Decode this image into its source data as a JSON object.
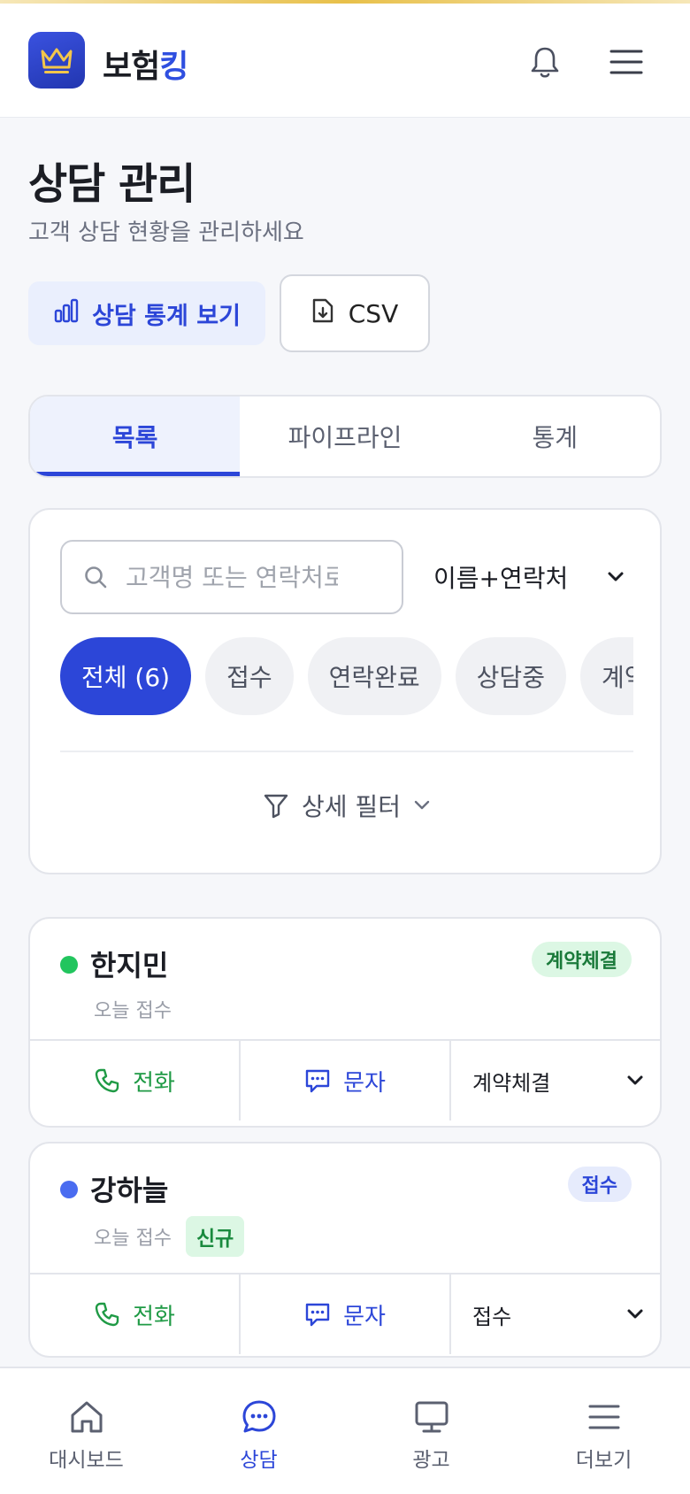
{
  "app": {
    "brand_part1": "보험",
    "brand_part2": "킹"
  },
  "page": {
    "title": "상담 관리",
    "subtitle": "고객 상담 현황을 관리하세요"
  },
  "toolbar": {
    "stats_label": "상담 통계 보기",
    "csv_label": "CSV"
  },
  "tabs": [
    {
      "label": "목록",
      "active": true
    },
    {
      "label": "파이프라인",
      "active": false
    },
    {
      "label": "통계",
      "active": false
    }
  ],
  "search": {
    "placeholder": "고객명 또는 연락처로 검색",
    "value": "",
    "type_selected": "이름+연락처"
  },
  "chips": [
    {
      "label": "전체 (6)",
      "active": true
    },
    {
      "label": "접수",
      "active": false
    },
    {
      "label": "연락완료",
      "active": false
    },
    {
      "label": "상담중",
      "active": false
    },
    {
      "label": "계약체결",
      "active": false
    }
  ],
  "advanced_filter_label": "상세 필터",
  "consultations": [
    {
      "name": "한지민",
      "received": "오늘 접수",
      "new_tag": "",
      "badge": "계약체결",
      "status": "계약체결",
      "dot_color": "#22c55e",
      "badge_bg": "#dcf7e4",
      "badge_color": "#1a7a3a",
      "call_label": "전화",
      "sms_label": "문자"
    },
    {
      "name": "강하늘",
      "received": "오늘 접수",
      "new_tag": "신규",
      "badge": "접수",
      "status": "접수",
      "dot_color": "#4a6cf0",
      "badge_bg": "#e6ebfc",
      "badge_color": "#2c46d8",
      "call_label": "전화",
      "sms_label": "문자"
    }
  ],
  "nav": [
    {
      "label": "대시보드",
      "icon": "home-icon",
      "active": false
    },
    {
      "label": "상담",
      "icon": "chat-icon",
      "active": true
    },
    {
      "label": "광고",
      "icon": "monitor-icon",
      "active": false
    },
    {
      "label": "더보기",
      "icon": "menu-icon",
      "active": false
    }
  ],
  "colors": {
    "primary": "#2c46d8",
    "success": "#1f9a45",
    "background": "#f6f7fa"
  }
}
